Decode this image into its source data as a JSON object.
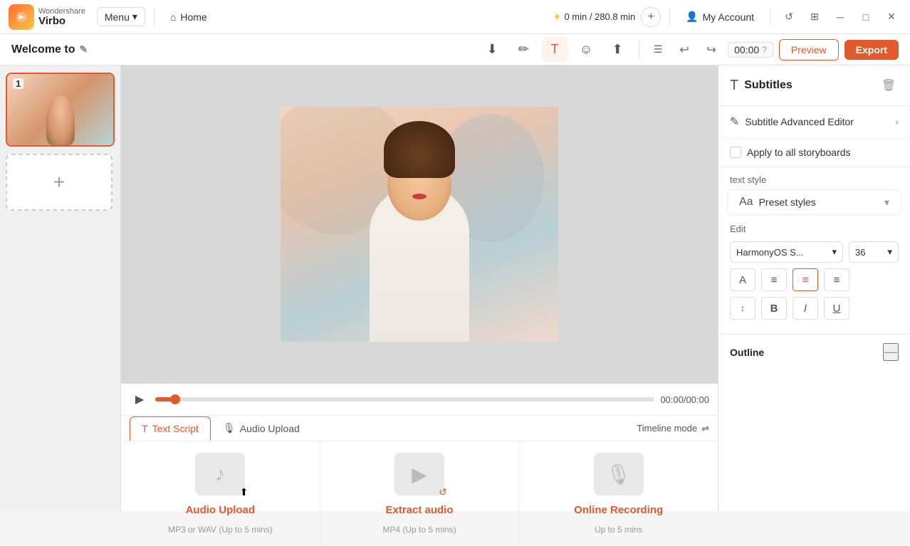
{
  "app": {
    "brand": "Wondershare",
    "name": "Virbo"
  },
  "topbar": {
    "menu_label": "Menu",
    "home_label": "Home",
    "duration": "0 min / 280.8 min",
    "account_label": "My Account"
  },
  "toolbar2": {
    "project_title": "Welcome to",
    "timecode": "00:00",
    "preview_label": "Preview",
    "export_label": "Export"
  },
  "storyboard": {
    "item1_number": "1",
    "add_label": "+"
  },
  "timeline": {
    "timecode": "00:00/00:00",
    "tab_text_script": "Text Script",
    "tab_audio_upload": "Audio Upload",
    "timeline_mode": "Timeline mode"
  },
  "upload_options": [
    {
      "title": "Audio Upload",
      "subtitle": "MP3 or WAV (Up to 5 mins)",
      "icon": "♪"
    },
    {
      "title": "Extract audio",
      "subtitle": "MP4 (Up to 5 mins)",
      "icon": "▶"
    },
    {
      "title": "Online Recording",
      "subtitle": "Up to 5 mins",
      "icon": "🎙"
    }
  ],
  "right_panel": {
    "title": "Subtitles",
    "subtitle_advanced_editor": "Subtitle Advanced Editor",
    "apply_all_label": "Apply to all storyboards",
    "text_style_label": "text style",
    "preset_styles_label": "Preset styles",
    "edit_label": "Edit",
    "font_name": "HarmonyOS S...",
    "font_size": "36",
    "outline_label": "Outline",
    "format_buttons": {
      "align_left": "align-left",
      "align_center": "align-center",
      "align_right_red": "align-right-red",
      "align_justify": "align-justify",
      "line_spacing": "line-spacing",
      "bold": "B",
      "italic": "I",
      "underline": "U"
    }
  }
}
